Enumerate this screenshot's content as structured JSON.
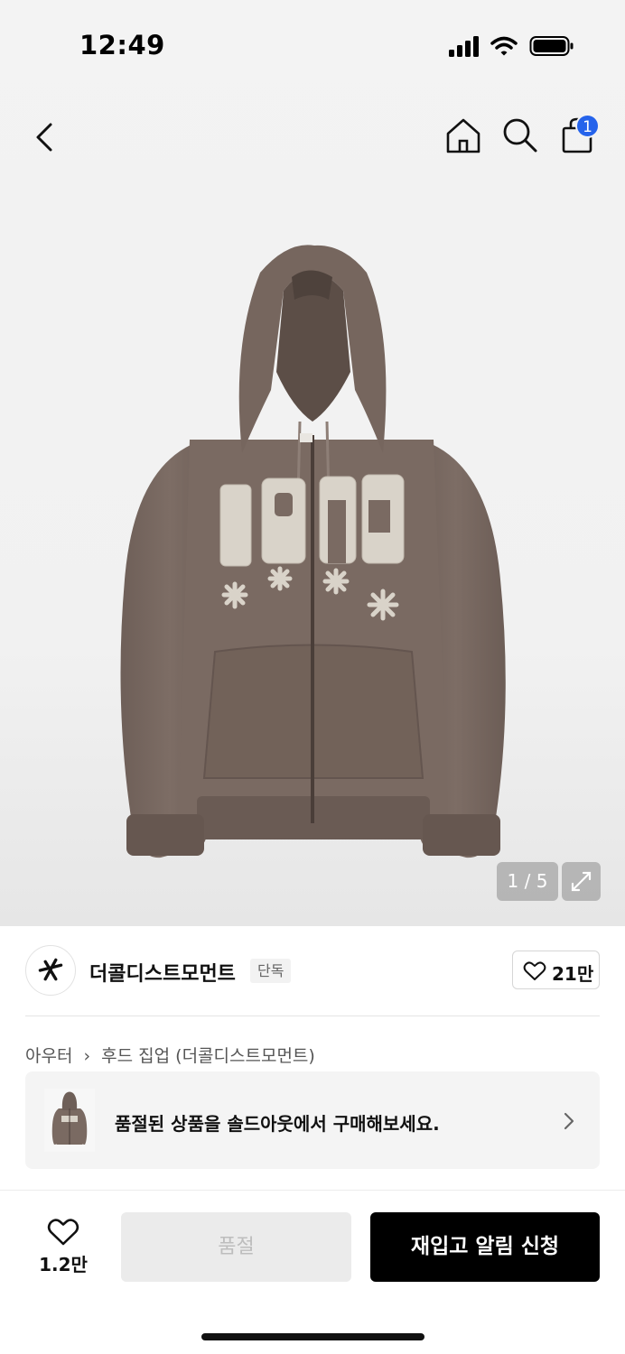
{
  "status": {
    "time": "12:49"
  },
  "nav": {
    "back_icon": "chevron-left-icon",
    "home_icon": "home-icon",
    "search_icon": "search-icon",
    "cart_icon": "shopping-bag-icon",
    "cart_count": "1",
    "badge_color": "#2563eb"
  },
  "gallery": {
    "image": "brown zip-up hoodie with 1972 patch",
    "counter": "1 / 5",
    "expand_icon": "expand-icon"
  },
  "brand": {
    "name": "더콜디스트모먼트",
    "tag": "단독",
    "like_count": "21만"
  },
  "breadcrumb": {
    "category": "아우터",
    "subcategory": "후드 집업 (더콜디스트모먼트)"
  },
  "soldout_card": {
    "text": "품절된 상품을 솔드아웃에서 구매해보세요."
  },
  "bottom_bar": {
    "wish_count": "1.2만",
    "soldout_label": "품절",
    "restock_label": "재입고 알림 신청"
  },
  "colors": {
    "primary": "#000000",
    "hoodie": "#7a6a62",
    "accent": "#2563eb"
  }
}
